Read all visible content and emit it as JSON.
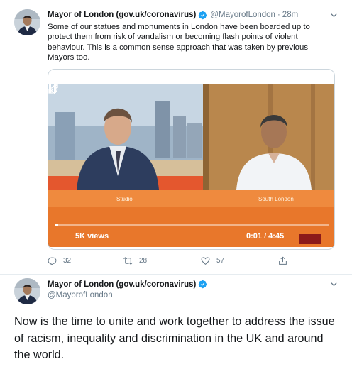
{
  "tweet1": {
    "display_name": "Mayor of London (gov.uk/coronavirus)",
    "handle": "@MayorofLondon",
    "separator": "·",
    "time": "28m",
    "text": "Some of our statues and monuments in London have been boarded up to protect them from risk of vandalism or becoming flash points of violent behaviour. This is a common sense approach that was taken by previous Mayors too.",
    "video": {
      "views": "5K views",
      "time_code": "0:01 / 4:45",
      "left_caption": "Studio",
      "right_caption": "South London"
    },
    "actions": {
      "reply_count": "32",
      "retweet_count": "28",
      "like_count": "57"
    }
  },
  "tweet2": {
    "display_name": "Mayor of London (gov.uk/coronavirus)",
    "handle": "@MayorofLondon",
    "text": "Now is the time to unite and work together to address the issue of racism, inequality and discrimination in the UK and around the world."
  },
  "colors": {
    "verified_blue": "#1da1f2",
    "secondary_text": "#657786",
    "divider": "#e6ecf0",
    "video_orange": "#e8772b"
  },
  "icons": [
    "verified-badge-icon",
    "chevron-down-icon",
    "play-icon",
    "volume-icon",
    "expand-icon",
    "reply-icon",
    "retweet-icon",
    "like-icon",
    "share-icon"
  ]
}
